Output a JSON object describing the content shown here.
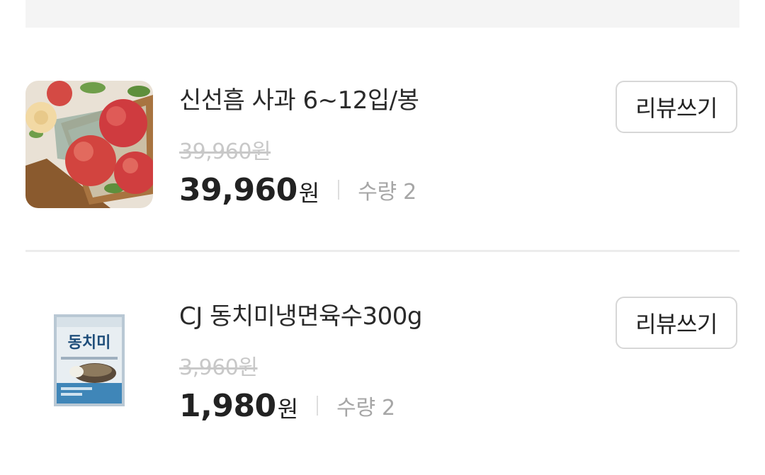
{
  "items": [
    {
      "name": "신선흠 사과 6~12입/봉",
      "original_price": "39,960원",
      "price": "39,960",
      "currency": "원",
      "quantity": "수량 2",
      "review_label": "리뷰쓰기",
      "image": "apple-basket-photo"
    },
    {
      "name": "CJ 동치미냉면육수300g",
      "original_price": "3,960원",
      "price": "1,980",
      "currency": "원",
      "quantity": "수량 2",
      "review_label": "리뷰쓰기",
      "image": "noodle-broth-package-photo"
    }
  ],
  "package_text": "동치미"
}
